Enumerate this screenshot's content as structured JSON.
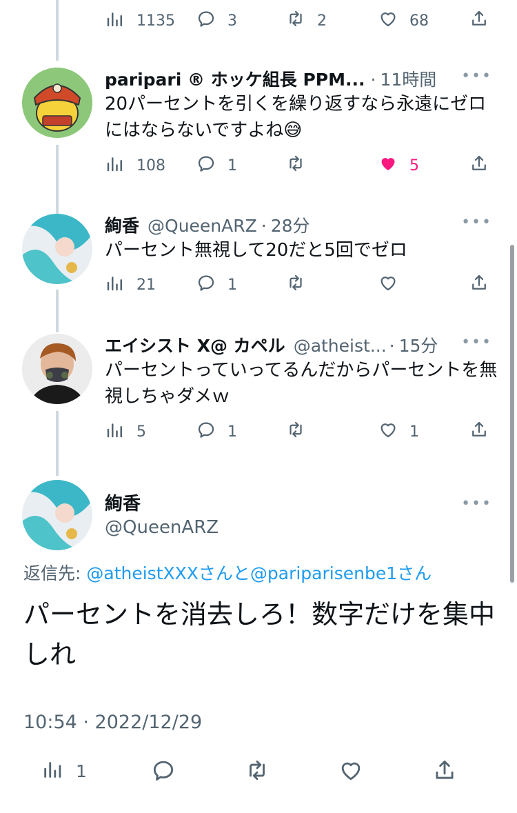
{
  "top_actions": {
    "views": "1135",
    "replies": "3",
    "retweets": "2",
    "likes": "68"
  },
  "tweets": [
    {
      "name": "paripari ® ホッケ組長 PPM...",
      "handle": "",
      "time": "11時間",
      "text": "20パーセントを引くを繰り返すなら永遠にゼロにはならないですよね😅",
      "views": "108",
      "replies": "1",
      "retweets": "",
      "likes": "5",
      "liked": true
    },
    {
      "name": "絢香",
      "handle": "@QueenARZ",
      "time": "28分",
      "text": "パーセント無視して20だと5回でゼロ",
      "views": "21",
      "replies": "1",
      "retweets": "",
      "likes": ""
    },
    {
      "name": "エイシスト X@ カペル",
      "handle": "@atheist...",
      "time": "15分",
      "text": "パーセントっていってるんだからパーセントを無視しちゃダメｗ",
      "views": "5",
      "replies": "1",
      "retweets": "",
      "likes": "1"
    }
  ],
  "main_tweet": {
    "name": "絢香",
    "handle": "@QueenARZ",
    "reply_prefix": "返信先: ",
    "reply_user1": "@atheistXXX",
    "reply_mid": "さんと",
    "reply_user2": "@pariparisenbe1",
    "reply_suffix": "さん",
    "text": "パーセントを消去しろ！数字だけを集中しれ",
    "datetime": "10:54 · 2022/12/29",
    "views": "1"
  },
  "more_label": "•••",
  "dot_sep": "·",
  "colors": {
    "accent": "#1d9bf0",
    "like": "#f91880",
    "secondary": "#536471"
  }
}
